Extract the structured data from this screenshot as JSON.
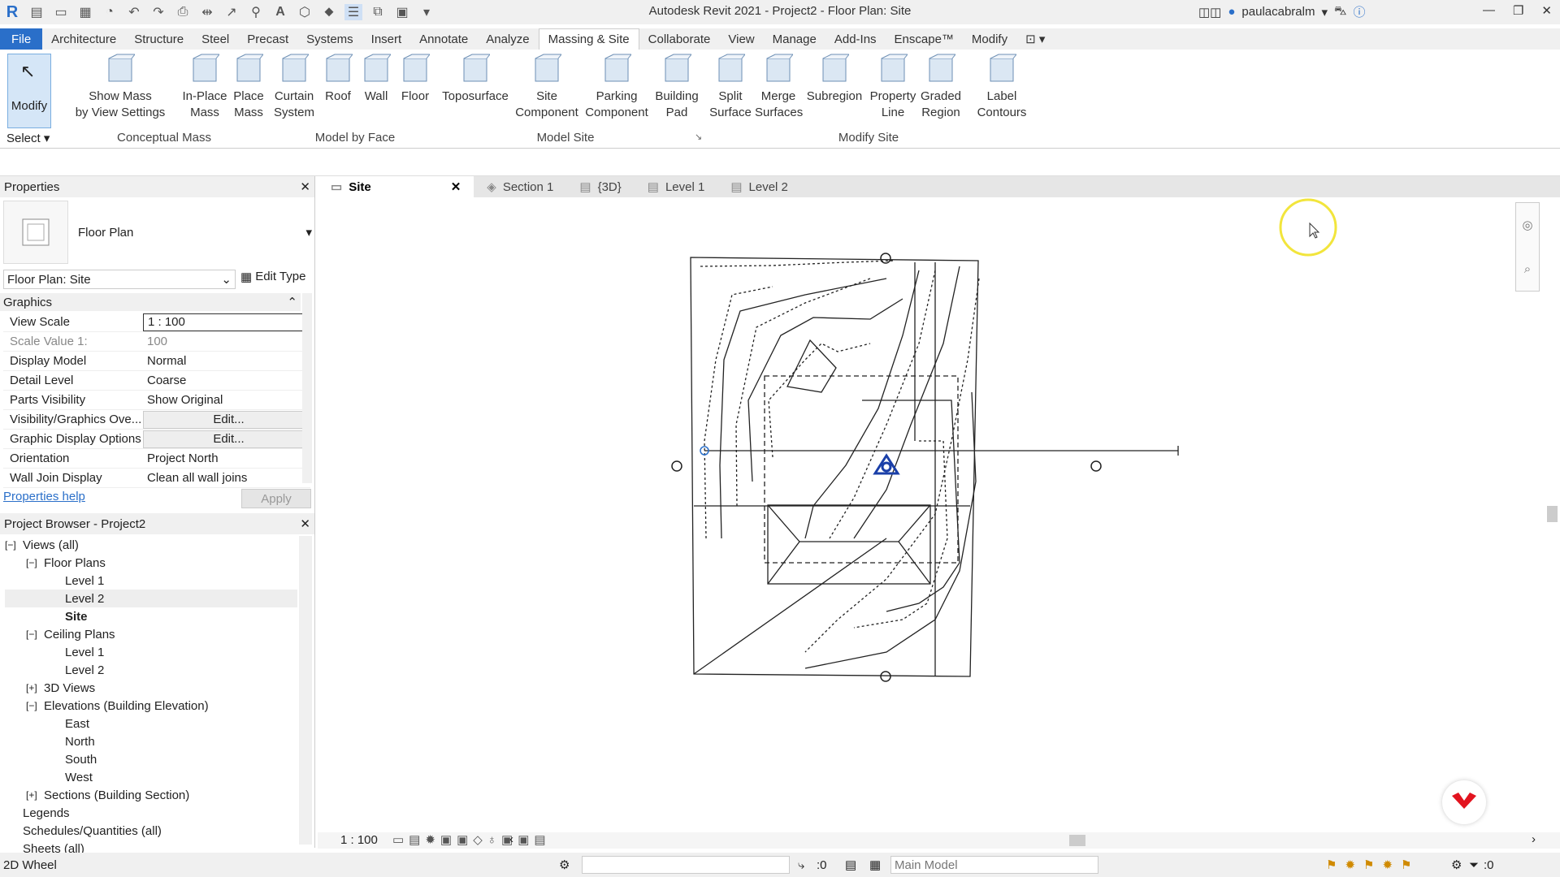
{
  "app": {
    "title": "Autodesk Revit 2021 - Project2 - Floor Plan: Site",
    "user": "paulacabralm"
  },
  "ribbon_tabs": [
    "File",
    "Architecture",
    "Structure",
    "Steel",
    "Precast",
    "Systems",
    "Insert",
    "Annotate",
    "Analyze",
    "Massing & Site",
    "Collaborate",
    "View",
    "Manage",
    "Add-Ins",
    "Enscape™",
    "Modify"
  ],
  "ribbon": {
    "modify": "Modify",
    "select": "Select",
    "buttons": [
      {
        "label1": "Show Mass",
        "label2": "by View Settings",
        "icon": "show-mass-icon"
      },
      {
        "label1": "In-Place",
        "label2": "Mass",
        "icon": "in-place-mass-icon"
      },
      {
        "label1": "Place",
        "label2": "Mass",
        "icon": "place-mass-icon"
      },
      {
        "label1": "Curtain",
        "label2": "System",
        "icon": "curtain-system-icon"
      },
      {
        "label1": "Roof",
        "label2": "",
        "icon": "roof-icon"
      },
      {
        "label1": "Wall",
        "label2": "",
        "icon": "wall-icon"
      },
      {
        "label1": "Floor",
        "label2": "",
        "icon": "floor-icon"
      },
      {
        "label1": "Toposurface",
        "label2": "",
        "icon": "toposurface-icon"
      },
      {
        "label1": "Site",
        "label2": "Component",
        "icon": "tree-icon"
      },
      {
        "label1": "Parking",
        "label2": "Component",
        "icon": "parking-icon"
      },
      {
        "label1": "Building",
        "label2": "Pad",
        "icon": "building-pad-icon"
      },
      {
        "label1": "Split",
        "label2": "Surface",
        "icon": "split-surface-icon"
      },
      {
        "label1": "Merge",
        "label2": "Surfaces",
        "icon": "merge-surfaces-icon"
      },
      {
        "label1": "Subregion",
        "label2": "",
        "icon": "subregion-icon"
      },
      {
        "label1": "Property",
        "label2": "Line",
        "icon": "property-line-icon"
      },
      {
        "label1": "Graded",
        "label2": "Region",
        "icon": "graded-region-icon"
      },
      {
        "label1": "Label",
        "label2": "Contours",
        "icon": "label-contours-icon"
      }
    ],
    "panels": [
      "Conceptual Mass",
      "Model by Face",
      "Model Site",
      "Modify Site"
    ]
  },
  "properties": {
    "title": "Properties",
    "type": "Floor Plan",
    "selector": "Floor Plan: Site",
    "edit_type": "Edit Type",
    "section": "Graphics",
    "rows": [
      {
        "k": "View Scale",
        "v": "1 : 100"
      },
      {
        "k": "Scale Value    1:",
        "v": "100"
      },
      {
        "k": "Display Model",
        "v": "Normal"
      },
      {
        "k": "Detail Level",
        "v": "Coarse"
      },
      {
        "k": "Parts Visibility",
        "v": "Show Original"
      },
      {
        "k": "Visibility/Graphics Ove...",
        "v": "Edit..."
      },
      {
        "k": "Graphic Display Options",
        "v": "Edit..."
      },
      {
        "k": "Orientation",
        "v": "Project North"
      },
      {
        "k": "Wall Join Display",
        "v": "Clean all wall joins"
      }
    ],
    "help": "Properties help",
    "apply": "Apply"
  },
  "browser": {
    "title": "Project Browser - Project2",
    "items": [
      {
        "t": "Views (all)",
        "lvl": 0,
        "exp": "−"
      },
      {
        "t": "Floor Plans",
        "lvl": 1,
        "exp": "−"
      },
      {
        "t": "Level 1",
        "lvl": 2,
        "exp": ""
      },
      {
        "t": "Level 2",
        "lvl": 2,
        "exp": ""
      },
      {
        "t": "Site",
        "lvl": 2,
        "exp": ""
      },
      {
        "t": "Ceiling Plans",
        "lvl": 1,
        "exp": "−"
      },
      {
        "t": "Level 1",
        "lvl": 2,
        "exp": ""
      },
      {
        "t": "Level 2",
        "lvl": 2,
        "exp": ""
      },
      {
        "t": "3D Views",
        "lvl": 1,
        "exp": "+"
      },
      {
        "t": "Elevations (Building Elevation)",
        "lvl": 1,
        "exp": "−"
      },
      {
        "t": "East",
        "lvl": 2,
        "exp": ""
      },
      {
        "t": "North",
        "lvl": 2,
        "exp": ""
      },
      {
        "t": "South",
        "lvl": 2,
        "exp": ""
      },
      {
        "t": "West",
        "lvl": 2,
        "exp": ""
      },
      {
        "t": "Sections (Building Section)",
        "lvl": 1,
        "exp": "+"
      },
      {
        "t": "Legends",
        "lvl": 0,
        "exp": ""
      },
      {
        "t": "Schedules/Quantities (all)",
        "lvl": 0,
        "exp": ""
      },
      {
        "t": "Sheets (all)",
        "lvl": 0,
        "exp": ""
      }
    ]
  },
  "view_tabs": [
    "Site",
    "Section 1",
    "{3D}",
    "Level 1",
    "Level 2"
  ],
  "view_scale": "1 : 100",
  "status": {
    "left": "2D Wheel",
    "zero": ":0",
    "model": "Main Model",
    "filter": ":0"
  },
  "colors": {
    "accent": "#2a6fc9",
    "bg": "#f0f0f0",
    "cursor_ring": "#f2e53c",
    "logo": "#e2141f"
  }
}
